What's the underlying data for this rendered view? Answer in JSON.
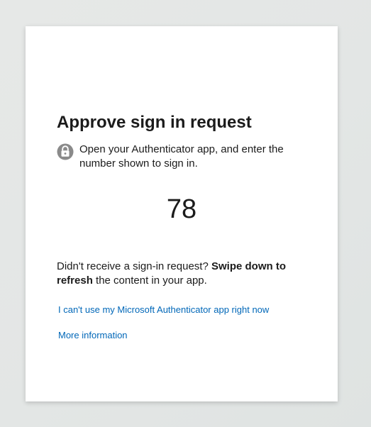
{
  "card": {
    "title": "Approve sign in request",
    "instruction": "Open your Authenticator app, and enter the number shown to sign in.",
    "instruction_icon": "lock-icon",
    "number": "78",
    "help_prefix": "Didn't receive a sign-in request? ",
    "help_bold": "Swipe down to refresh",
    "help_suffix": " the content in your app.",
    "links": {
      "cant_use": "I can't use my Microsoft Authenticator app right now",
      "more_info": "More information"
    }
  },
  "colors": {
    "link": "#0067b8",
    "text": "#1b1b1b",
    "card_background": "#ffffff",
    "page_background": "#e4e7e6"
  }
}
